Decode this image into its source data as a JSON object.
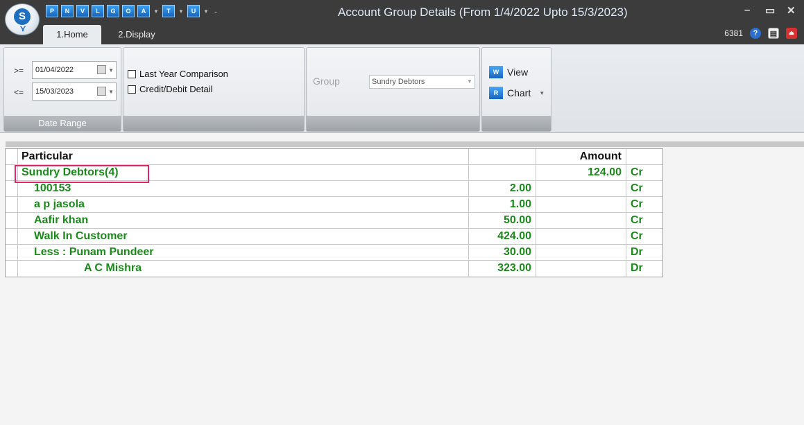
{
  "titlebar": {
    "title": "Account Group Details (From 1/4/2022 Upto 15/3/2023)",
    "logo_letter": "S",
    "quick_access": [
      "P",
      "N",
      "V",
      "L",
      "G",
      "O",
      "A",
      "T",
      "U"
    ],
    "minimize_icon": "minimize-icon",
    "maximize_icon": "maximize-icon",
    "close_icon": "close-icon"
  },
  "tabs": [
    {
      "label": "1.Home",
      "active": true
    },
    {
      "label": "2.Display",
      "active": false
    }
  ],
  "tabstrip_right": {
    "user_number": "6381"
  },
  "ribbon": {
    "date_range": {
      "from_label": ">=",
      "from_value": "01/04/2022",
      "to_label": "<=",
      "to_value": "15/03/2023",
      "footer": "Date Range"
    },
    "options": {
      "last_year_comparison": "Last Year Comparison",
      "credit_debit_detail": "Credit/Debit Detail"
    },
    "group": {
      "label": "Group",
      "value": "Sundry Debtors"
    },
    "actions": {
      "view": "View",
      "view_icon_letter": "W",
      "chart": "Chart",
      "chart_icon_letter": "R"
    }
  },
  "grid": {
    "headers": {
      "particular": "Particular",
      "amount": "Amount"
    },
    "rows": [
      {
        "particular": "Sundry Debtors(4)",
        "amount1": "",
        "amount2": "124.00",
        "drcr": "Cr",
        "indent": 0
      },
      {
        "particular": "100153",
        "amount1": "2.00",
        "amount2": "",
        "drcr": "Cr",
        "indent": 1
      },
      {
        "particular": "a p jasola",
        "amount1": "1.00",
        "amount2": "",
        "drcr": "Cr",
        "indent": 1
      },
      {
        "particular": "Aafir khan",
        "amount1": "50.00",
        "amount2": "",
        "drcr": "Cr",
        "indent": 1
      },
      {
        "particular": "Walk In Customer",
        "amount1": "424.00",
        "amount2": "",
        "drcr": "Cr",
        "indent": 1
      },
      {
        "particular": "Less :  Punam Pundeer",
        "amount1": "30.00",
        "amount2": "",
        "drcr": "Dr",
        "indent": 1
      },
      {
        "particular": "A C Mishra",
        "amount1": "323.00",
        "amount2": "",
        "drcr": "Dr",
        "indent": 2
      }
    ]
  },
  "colors": {
    "titlebar": "#3c3c3c",
    "row_text": "#1a8a1a",
    "highlight": "#e0256a"
  }
}
